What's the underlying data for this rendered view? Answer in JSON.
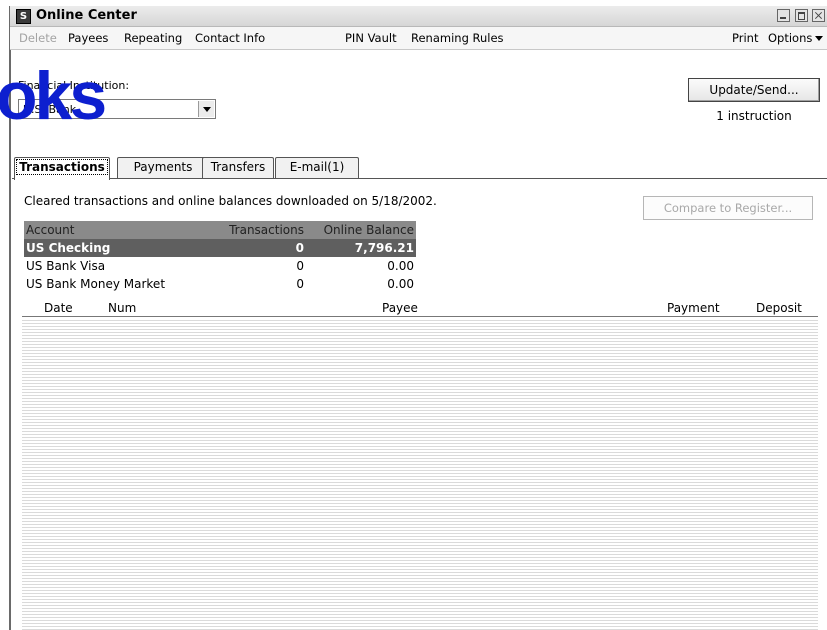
{
  "window": {
    "title": "Online Center",
    "app_icon": "S"
  },
  "menu": {
    "items": [
      {
        "label": "Delete",
        "enabled": false
      },
      {
        "label": "Payees",
        "enabled": true
      },
      {
        "label": "Repeating",
        "enabled": true
      },
      {
        "label": "Contact Info",
        "enabled": true
      },
      {
        "label": "PIN Vault",
        "enabled": true
      },
      {
        "label": "Renaming Rules",
        "enabled": true
      },
      {
        "label": "Print",
        "enabled": true
      },
      {
        "label": "Options",
        "enabled": true
      }
    ]
  },
  "institution": {
    "label": "Financial Institution:",
    "value": "U.S. Bank"
  },
  "update": {
    "label": "Update/Send...",
    "status": "1 instruction"
  },
  "tabs": [
    {
      "label": "Transactions",
      "active": true
    },
    {
      "label": "Payments",
      "active": false
    },
    {
      "label": "Transfers",
      "active": false
    },
    {
      "label": "E-mail(1)",
      "active": false
    }
  ],
  "cleared_text": "Cleared transactions and online balances downloaded on 5/18/2002.",
  "compare_label": "Compare to Register...",
  "accounts": {
    "headers": [
      "Account",
      "Transactions",
      "Online Balance"
    ],
    "rows": [
      {
        "account": "US Checking",
        "transactions": "0",
        "balance": "7,796.21",
        "selected": true
      },
      {
        "account": "US Bank Visa",
        "transactions": "0",
        "balance": "0.00",
        "selected": false
      },
      {
        "account": "US Bank Money Market",
        "transactions": "0",
        "balance": "0.00",
        "selected": false
      }
    ]
  },
  "register": {
    "headers": [
      "Date",
      "Num",
      "Payee",
      "Payment",
      "Deposit"
    ]
  },
  "watermark": {
    "text": "oks",
    "logo_text": "DropBooks"
  },
  "colors": {
    "watermark_blue": "#0d1fcf",
    "cloud": "#a9e3ea",
    "selected_row": "#5f5f5f"
  }
}
